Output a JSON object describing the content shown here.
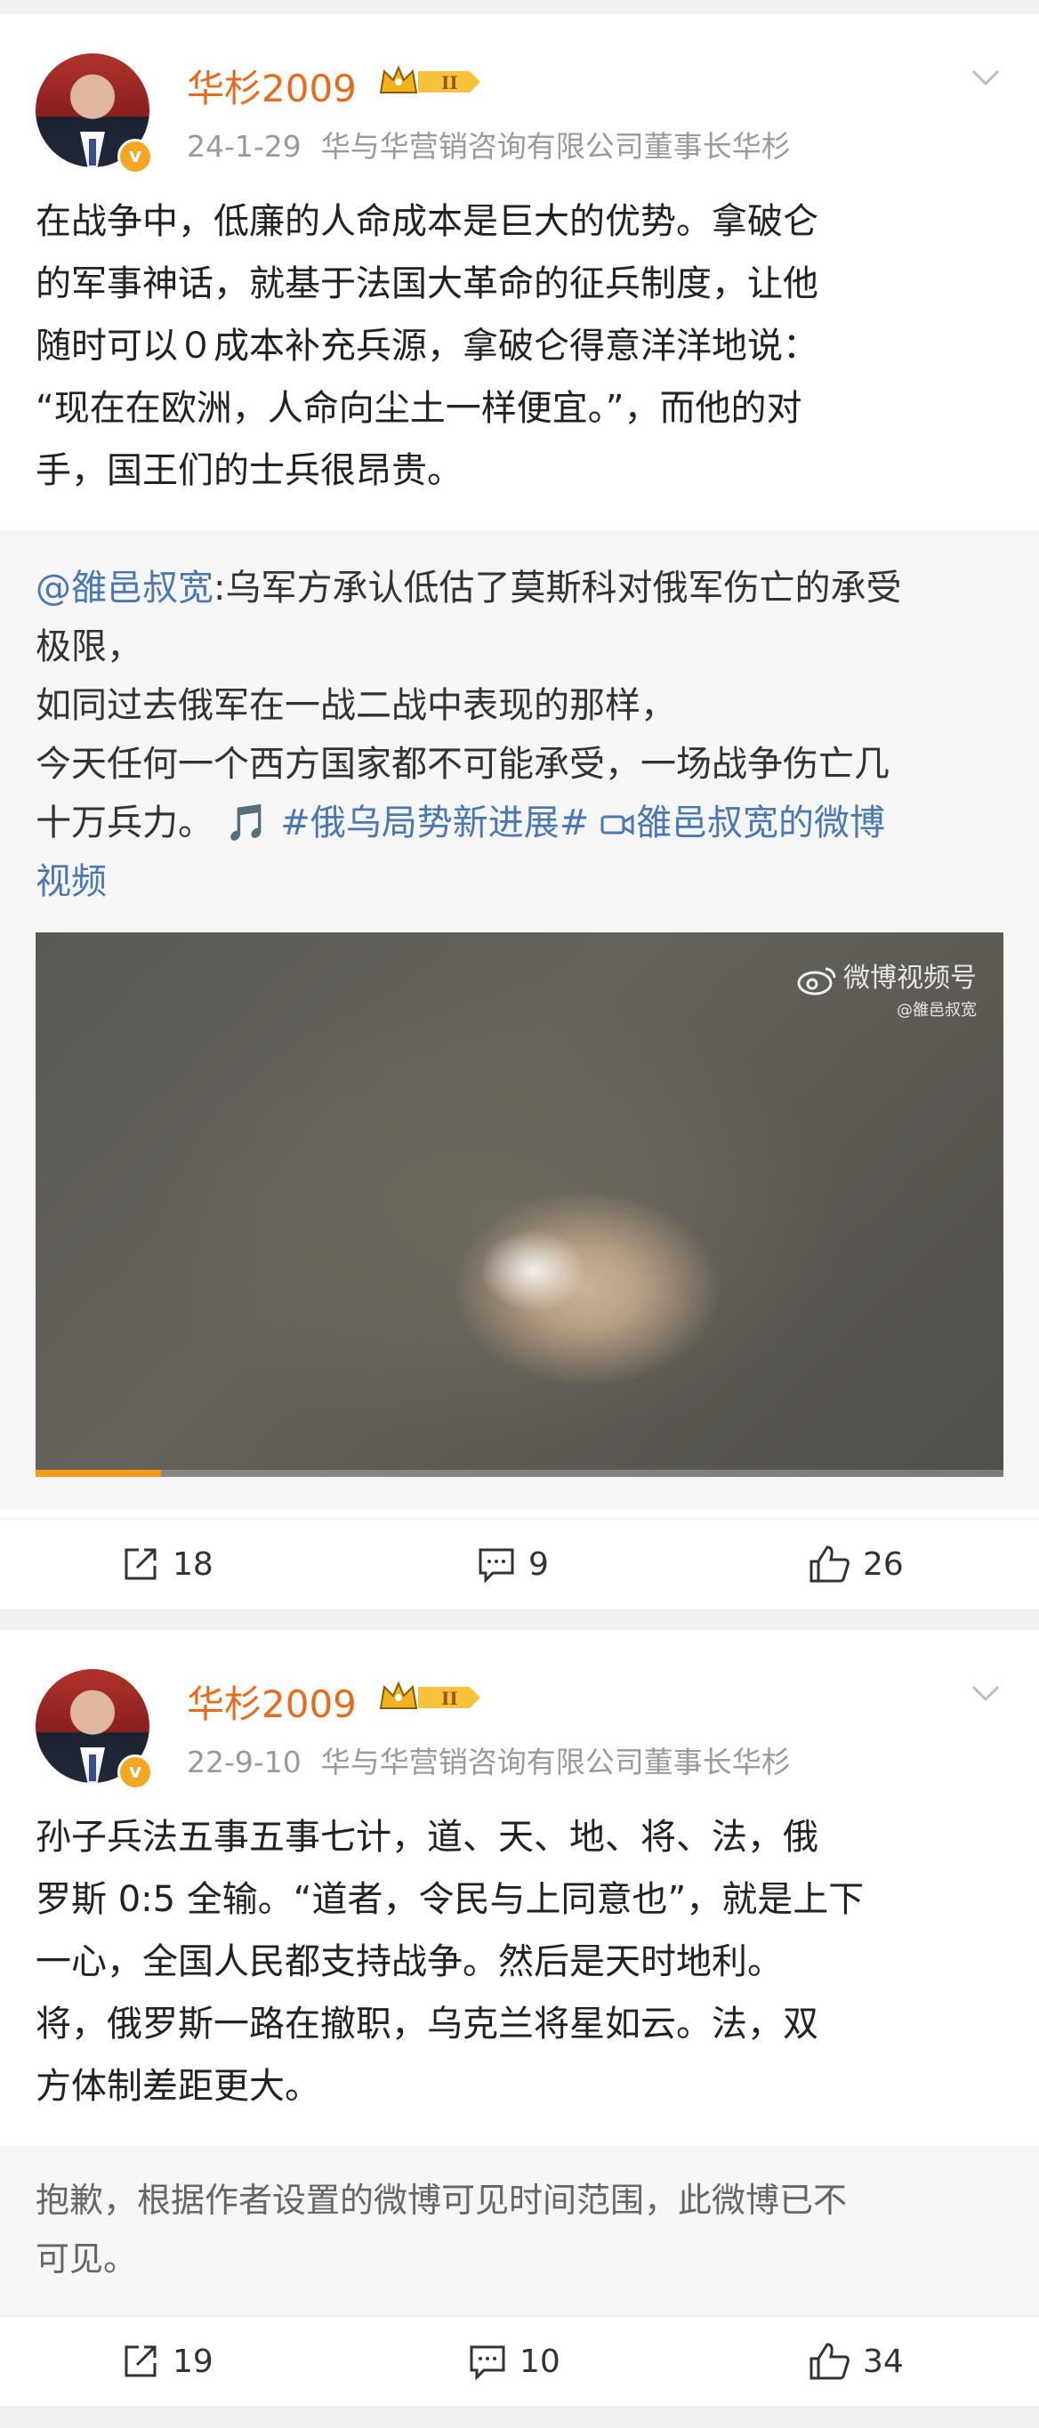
{
  "posts": [
    {
      "username": "华杉2009",
      "vip_level": "II",
      "date": "24-1-29",
      "source": "华与华营销咨询有限公司董事长华杉",
      "body": [
        "在战争中，低廉的人命成本是巨大的优势。拿破仑",
        "的军事神话，就基于法国大革命的征兵制度，让他",
        "随时可以０成本补充兵源，拿破仑得意洋洋地说：",
        "“现在在欧洲，人命向尘土一样便宜。”，而他的对",
        "手，国王们的士兵很昂贵。"
      ],
      "repost": {
        "mention": "@雒邑叔宽",
        "line1": ":乌军方承认低估了莫斯科对俄军伤亡的承受",
        "line2": "极限，",
        "line3": "如同过去俄军在一战二战中表现的那样，",
        "line4": "今天任何一个西方国家都不可能承受，一场战争伤亡几",
        "line5_text": "十万兵力。",
        "music_icon": "🎵",
        "topic": "#俄乌局势新进展#",
        "video_link": "雒邑叔宽的微博",
        "video_link_cont": "视频",
        "video": {
          "watermark": "微博视频号",
          "watermark_sub": "@雒邑叔宽",
          "progress": 0.13
        }
      },
      "reposts": "18",
      "comments": "9",
      "likes": "26"
    },
    {
      "username": "华杉2009",
      "vip_level": "II",
      "date": "22-9-10",
      "source": "华与华营销咨询有限公司董事长华杉",
      "body": [
        "孙子兵法五事五事七计，道、天、地、将、法，俄",
        "罗斯 0:5 全输。“道者，令民与上同意也”，就是上下",
        "一心，全国人民都支持战争。然后是天时地利。",
        "将，俄罗斯一路在撤职，乌克兰将星如云。法，双",
        "方体制差距更大。"
      ],
      "hidden_note": [
        "抱歉，根据作者设置的微博可见时间范围，此微博已不",
        "可见。"
      ],
      "reposts": "19",
      "comments": "10",
      "likes": "34"
    }
  ],
  "colors": {
    "username": "#e86b1c",
    "link": "#4a78b5",
    "progress": "#f29a1a",
    "verified": "#f5a623"
  }
}
